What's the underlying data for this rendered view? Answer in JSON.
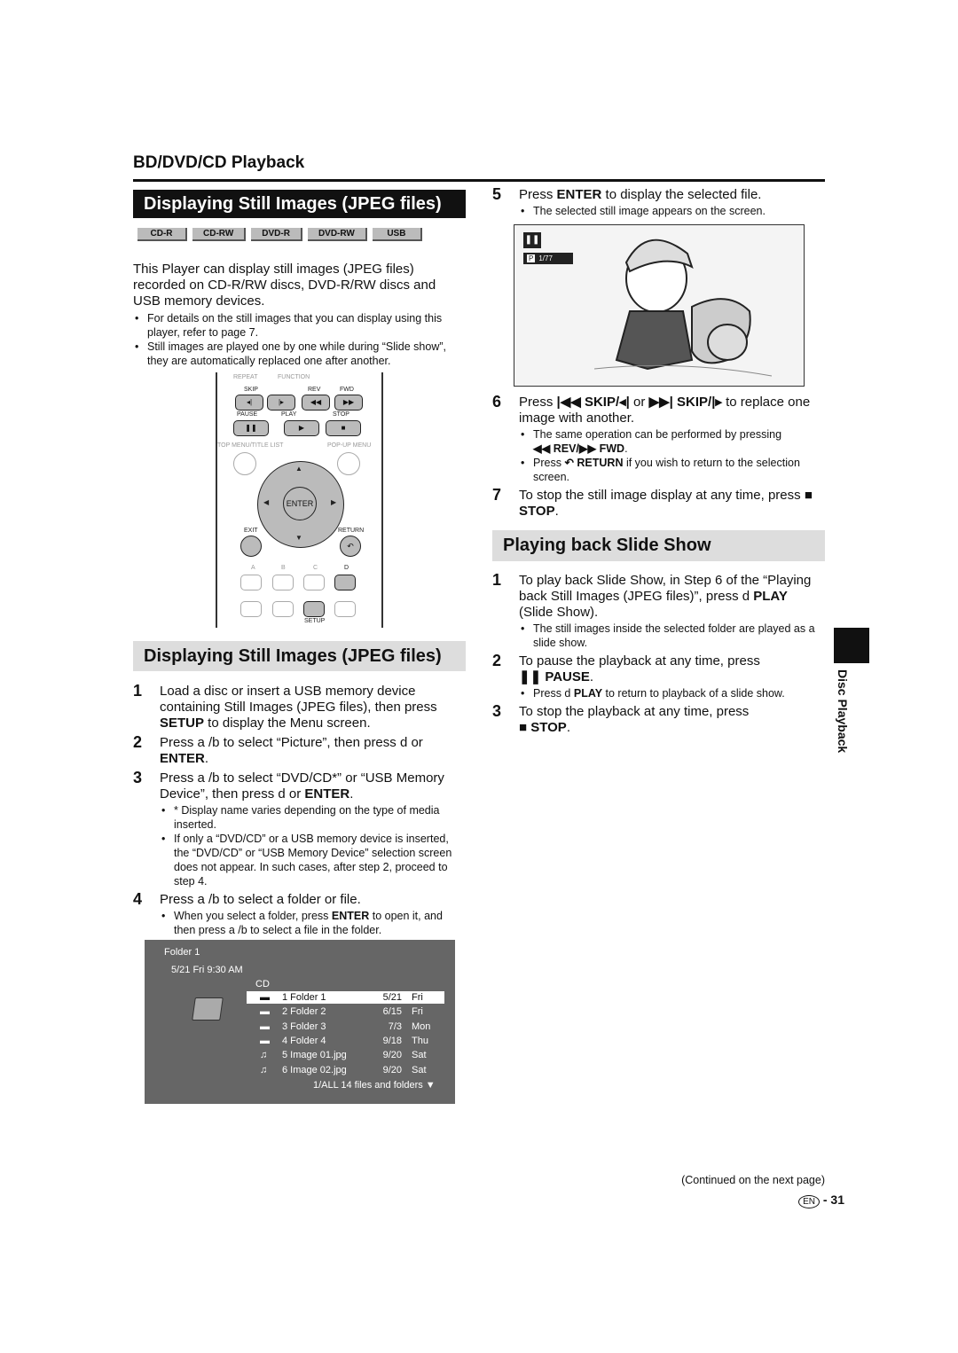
{
  "section_header": "BD/DVD/CD Playback",
  "left": {
    "title1": "Displaying Still Images (JPEG files)",
    "badges": [
      "CD-R",
      "CD-RW",
      "DVD-R",
      "DVD-RW",
      "USB"
    ],
    "intro": "This Player can display still images (JPEG files) recorded on CD-R/RW discs, DVD-R/RW discs and USB memory devices.",
    "bullets": [
      "For details on the still images that you can display using this player, refer to page 7.",
      "Still images are played one by one while during “Slide show”, they are automatically replaced one after another."
    ],
    "remote": {
      "repeat": "REPEAT",
      "function": "FUNCTION",
      "skip": "SKIP",
      "rev": "REV",
      "fwd": "FWD",
      "pause": "PAUSE",
      "play": "PLAY",
      "stop": "STOP",
      "top_menu": "TOP MENU/TITLE LIST",
      "popup_menu": "POP-UP MENU",
      "enter": "ENTER",
      "exit": "EXIT",
      "return": "RETURN",
      "a": "A",
      "b": "B",
      "c": "C",
      "d": "D",
      "setup": "SETUP"
    },
    "title2": "Displaying Still Images (JPEG files)",
    "steps": {
      "s1": {
        "num": "1",
        "t1": "Load a disc or insert a USB memory device containing Still Images (JPEG files), then press ",
        "b1": "SETUP",
        "t2": " to display the Menu screen."
      },
      "s2": {
        "num": "2",
        "t1": "Press a /b  to select “Picture”, then press d  or ",
        "b1": "ENTER",
        "t2": "."
      },
      "s3": {
        "num": "3",
        "t1": "Press a /b  to select “DVD/CD*” or “USB Memory Device”, then press d  or ",
        "b1": "ENTER",
        "t2": ".",
        "note": "*  Display name varies depending on the type of media inserted.",
        "bullet": "If only a “DVD/CD” or a USB memory device is inserted, the “DVD/CD” or “USB Memory Device” selection screen does not appear. In such cases, after step 2, proceed to step 4."
      },
      "s4": {
        "num": "4",
        "t1": "Press a /b  to select a folder or file.",
        "bt1": "When you select a folder, press ",
        "bb": "ENTER",
        "bt2": " to open it, and then press a /b  to select a file in the folder."
      }
    },
    "screen": {
      "folder": "Folder 1",
      "datetime": "5/21  Fri  9:30 AM",
      "media": "CD",
      "rows": [
        {
          "icon": "folder",
          "name": "1 Folder 1",
          "date": "5/21",
          "day": "Fri",
          "selected": true
        },
        {
          "icon": "folder",
          "name": "2 Folder 2",
          "date": "6/15",
          "day": "Fri"
        },
        {
          "icon": "folder",
          "name": "3 Folder 3",
          "date": "7/3",
          "day": "Mon"
        },
        {
          "icon": "folder",
          "name": "4 Folder 4",
          "date": "9/18",
          "day": "Thu"
        },
        {
          "icon": "music-note",
          "name": "5 Image 01.jpg",
          "date": "9/20",
          "day": "Sat"
        },
        {
          "icon": "music-note",
          "name": "6 Image 02.jpg",
          "date": "9/20",
          "day": "Sat"
        }
      ],
      "footer": "1/ALL  14 files and folders"
    }
  },
  "right": {
    "s5": {
      "num": "5",
      "t1": "Press ",
      "b1": "ENTER",
      "t2": " to display the selected file.",
      "bullet": "The selected still image appears on the screen."
    },
    "photo": {
      "counter": "1/77",
      "p": "P"
    },
    "s6": {
      "num": "6",
      "t1": "Press ",
      "b1": "SKIP/",
      "t2": " or ",
      "b2": "SKIP/",
      "t3": " to replace one image with another.",
      "bu1": "The same operation can be performed by pressing ",
      "bu1b": "REV/",
      "bu1c": "FWD",
      "bu2a": "Press ",
      "bu2b": "RETURN",
      "bu2c": " if you wish to return to the selection screen."
    },
    "s7": {
      "num": "7",
      "t1": "To stop the still image display at any time, press ",
      "b1": "STOP",
      "t2": "."
    },
    "title3": "Playing back Slide Show",
    "ss1": {
      "num": "1",
      "t1": "To play back Slide Show, in Step 6 of the “Playing back Still Images (JPEG files)”, press d  ",
      "b1": "PLAY",
      "t2": " (Slide Show).",
      "bullet": "The still images inside the selected folder are played as a slide show."
    },
    "ss2": {
      "num": "2",
      "t1": "To pause the playback at any time, press ",
      "b1": "PAUSE",
      "t2": ".",
      "bt1": "Press d  ",
      "bb": "PLAY",
      "bt2": " to return to playback of a slide show."
    },
    "ss3": {
      "num": "3",
      "t1": "To stop the playback at any time, press ",
      "b1": "STOP",
      "t2": "."
    }
  },
  "side_tab": "Disc Playback",
  "continued": "(Continued on the next page)",
  "page": {
    "lang": "EN",
    "sep": "-",
    "number": "31"
  }
}
